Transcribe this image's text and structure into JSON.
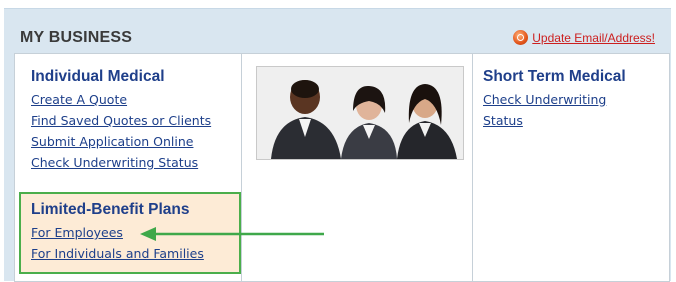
{
  "header": {
    "title": "MY BUSINESS",
    "update_link": "Update Email/Address!"
  },
  "individual_medical": {
    "title": "Individual Medical",
    "links": [
      "Create A Quote",
      "Find Saved Quotes or Clients",
      "Submit Application Online",
      "Check Underwriting Status"
    ]
  },
  "limited_benefit": {
    "title": "Limited-Benefit Plans",
    "links": [
      "For Employees",
      "For Individuals and Families"
    ]
  },
  "short_term_medical": {
    "title": "Short Term Medical",
    "link_lines": [
      "Check Underwriting",
      "Status"
    ]
  },
  "colors": {
    "panel_bg": "#d9e6f0",
    "link_blue": "#1d3f8a",
    "highlight_bg": "#fdebd6",
    "highlight_border": "#4bae4b",
    "alert_red": "#cc1f1f"
  }
}
